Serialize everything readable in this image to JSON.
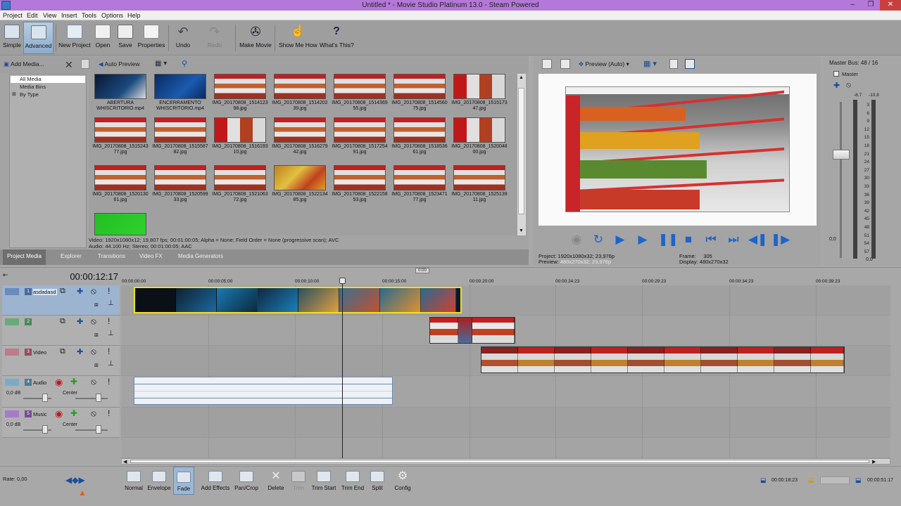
{
  "window": {
    "title": "Untitled * - Movie Studio Platinum 13.0 - Steam Powered",
    "minimize": "–",
    "maximize": "❐",
    "close": "✕"
  },
  "menu": [
    "Project",
    "Edit",
    "View",
    "Insert",
    "Tools",
    "Options",
    "Help"
  ],
  "toolbar": {
    "simple": "Simple",
    "advanced": "Advanced",
    "new_project": "New Project",
    "open": "Open",
    "save": "Save",
    "properties": "Properties",
    "undo": "Undo",
    "redo": "Redo",
    "make_movie": "Make Movie",
    "show_me_how": "Show Me How",
    "whats_this": "What's This?"
  },
  "media": {
    "add_media": "Add Media...",
    "auto_preview": "Auto Preview",
    "tree": [
      "All Media",
      "Media Bins",
      "By Type"
    ],
    "thumbs": [
      {
        "cap": "ABERTURA\nWHISCRITORIO.mp4",
        "kind": "dark"
      },
      {
        "cap": "ENCERRAMENTO\nWHISCRITORIO.mp4",
        "kind": "blue"
      },
      {
        "cap": "IMG_20170808_1514123\n98.jpg",
        "kind": "shop"
      },
      {
        "cap": "IMG_20170808_1514202\n39.jpg",
        "kind": "shop"
      },
      {
        "cap": "IMG_20170808_1514369\n55.jpg",
        "kind": "shop"
      },
      {
        "cap": "IMG_20170808_1514560\n75.jpg",
        "kind": "shop"
      },
      {
        "cap": "IMG_20170808_1515173\n47.jpg",
        "kind": "red"
      },
      {
        "cap": "IMG_20170808_1515243\n77.jpg",
        "kind": "shop"
      },
      {
        "cap": "IMG_20170808_1515587\n82.jpg",
        "kind": "shop"
      },
      {
        "cap": "IMG_20170808_1516193\n10.jpg",
        "kind": "red"
      },
      {
        "cap": "IMG_20170808_1516279\n42.jpg",
        "kind": "shop"
      },
      {
        "cap": "IMG_20170808_1517254\n91.jpg",
        "kind": "shop"
      },
      {
        "cap": "IMG_20170808_1518536\n61.jpg",
        "kind": "shop"
      },
      {
        "cap": "IMG_20170808_1520048\n00.jpg",
        "kind": "red"
      },
      {
        "cap": "IMG_20170808_1520130\n61.jpg",
        "kind": "shop"
      },
      {
        "cap": "IMG_20170808_1520599\n33.jpg",
        "kind": "shop"
      },
      {
        "cap": "IMG_20170808_1521063\n72.jpg",
        "kind": "shop"
      },
      {
        "cap": "IMG_20170808_1522134\n85.jpg",
        "kind": "yellow"
      },
      {
        "cap": "IMG_20170808_1522158\n53.jpg",
        "kind": "shop"
      },
      {
        "cap": "IMG_20170808_1523471\n77.jpg",
        "kind": "shop"
      },
      {
        "cap": "IMG_20170808_1525139\n11.jpg",
        "kind": "shop"
      },
      {
        "cap": "",
        "kind": "green"
      }
    ],
    "info_line1": "Video: 1920x1080x12; 19,807 fps; 00:01:00:05; Alpha = None; Field Order = None (progressive scan); AVC",
    "info_line2": "Audio: 44.100 Hz; Stereo; 00:01:00:05; AAC",
    "tabs": [
      "Project Media",
      "Explorer",
      "Transitions",
      "Video FX",
      "Media Generators"
    ]
  },
  "preview": {
    "mode": "Preview (Auto)",
    "project_label": "Project:",
    "project_val": "1920x1080x32; 23,976p",
    "preview_label": "Preview:",
    "preview_val": "480x270x32; 23,976p",
    "frame_label": "Frame:",
    "frame_val": "305",
    "display_label": "Display:",
    "display_val": "480x270x32"
  },
  "master": {
    "title": "Master Bus: 48 / 16",
    "label": "Master",
    "left_peak": "-8,7",
    "right_peak": "-10,8",
    "scale": [
      "3",
      "6",
      "9",
      "12",
      "15",
      "18",
      "21",
      "24",
      "27",
      "30",
      "33",
      "36",
      "39",
      "42",
      "45",
      "48",
      "51",
      "54",
      "57"
    ],
    "bottom_left": "0,0",
    "bottom_right": "0,0"
  },
  "timeline": {
    "timecode": "00:00:12:17",
    "loop_marker": "0:00",
    "ticks": [
      "00:00:00:00",
      "00:00:05:00",
      "00:00:10:00",
      "00:00:15:00",
      "00:00:20:00",
      "00:00:24:23",
      "00:00:29:23",
      "00:00:34:23",
      "00:00:39:23"
    ],
    "tracks": [
      {
        "num": "1",
        "name": "asdadasd",
        "color": "#4a6a9a"
      },
      {
        "num": "2",
        "name": "",
        "color": "#4a8a5a"
      },
      {
        "num": "3",
        "name": "Video",
        "color": "#9a4a5a"
      },
      {
        "num": "4",
        "name": "Audio",
        "color": "#4a7a9a",
        "db": "0,0 dB",
        "pan": "Center"
      },
      {
        "num": "5",
        "name": "Music",
        "color": "#7a4a9a",
        "db": "0,0 dB",
        "pan": "Center"
      }
    ]
  },
  "bottom": {
    "rate": "Rate: 0,00",
    "tools": [
      "Normal",
      "Envelope",
      "Fade",
      "Add Effects",
      "Pan/Crop",
      "Delete",
      "Trim",
      "Trim Start",
      "Trim End",
      "Split",
      "Config"
    ],
    "time_left": "00:00:18:23",
    "time_right": "00:00:51:17"
  }
}
